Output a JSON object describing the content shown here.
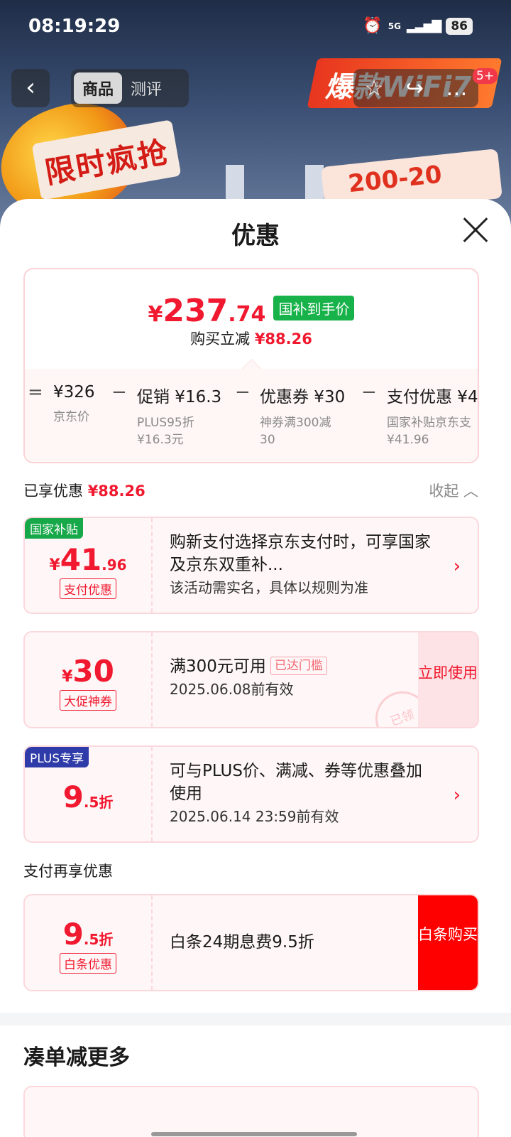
{
  "status_bar": {
    "time": "08:19:29",
    "network": "5G",
    "battery": "86"
  },
  "nav": {
    "tab_product": "商品",
    "tab_review": "测评",
    "badge": "5+"
  },
  "banner": {
    "text_left": "限时疯抢",
    "text_wifi": "爆款WiFi7",
    "text_coupon": "200-20"
  },
  "sheet": {
    "title": "优惠",
    "price": {
      "symbol": "¥",
      "integer": "237",
      "decimal": ".74",
      "tag": "国补到手价",
      "reduce_label": "购买立减",
      "reduce_value": "¥88.26"
    },
    "formula": [
      {
        "op": "=",
        "head": "¥326",
        "sub1": "京东价",
        "sub2": ""
      },
      {
        "op": "−",
        "head": "促销 ¥16.3",
        "sub1": "PLUS95折",
        "sub2": "¥16.3元"
      },
      {
        "op": "−",
        "head": "优惠券 ¥30",
        "sub1": "神券满300减",
        "sub2": "30"
      },
      {
        "op": "−",
        "head": "支付优惠 ¥4",
        "sub1": "国家补贴京东支",
        "sub2": "¥41.96"
      }
    ],
    "enjoyed_label": "已享优惠",
    "enjoyed_value": "¥88.26",
    "collapse_label": "收起",
    "cards": [
      {
        "corner": "国家补贴",
        "corner_color": "#17a84a",
        "symbol": "¥",
        "amount": "41",
        "amount_dec": ".96",
        "label": "支付优惠",
        "line1": "购新支付选择京东支付时，可享国家及京东双重补...",
        "line2": "该活动需实名，具体以规则为准"
      },
      {
        "symbol": "¥",
        "amount": "30",
        "label": "大促神券",
        "line1": "满300元可用",
        "threshold": "已达门槛",
        "line2": "2025.06.08前有效",
        "button": "立即使用",
        "stamp": "已领"
      },
      {
        "corner": "PLUS专享",
        "corner_color": "#2f3ba8",
        "amount": "9",
        "amount_dec": ".5折",
        "line1": "可与PLUS价、满减、券等优惠叠加使用",
        "line2": "2025.06.14 23:59前有效"
      }
    ],
    "pay_title": "支付再享优惠",
    "pay_card": {
      "amount": "9",
      "amount_dec": ".5折",
      "label": "白条优惠",
      "line1": "白条24期息费9.5折",
      "button": "白条购买"
    },
    "more_title": "凑单减更多"
  }
}
